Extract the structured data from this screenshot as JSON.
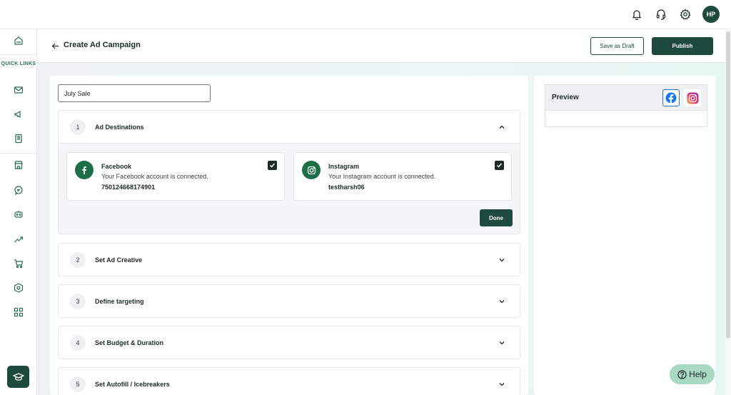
{
  "topbar": {
    "avatar_initials": "HP",
    "icons": [
      "bell-icon",
      "headset-icon",
      "settings-icon"
    ]
  },
  "sidebar": {
    "quick_links_label": "QUICK LINKS",
    "items": [
      "home-icon",
      "mail-icon",
      "megaphone-icon",
      "book-icon",
      "store-icon",
      "chat-icon",
      "bot-icon",
      "growth-icon",
      "cart-icon",
      "hexagon-icon",
      "apps-grid-icon",
      "academy-icon"
    ]
  },
  "header": {
    "title": "Create Ad Campaign",
    "save_draft_label": "Save as Draft",
    "publish_label": "Publish"
  },
  "campaign": {
    "name_value": "July Sale"
  },
  "steps": [
    {
      "number": "1",
      "title": "Ad Destinations",
      "expanded": true
    },
    {
      "number": "2",
      "title": "Set Ad Creative",
      "expanded": false
    },
    {
      "number": "3",
      "title": "Define targeting",
      "expanded": false
    },
    {
      "number": "4",
      "title": "Set Budget & Duration",
      "expanded": false
    },
    {
      "number": "5",
      "title": "Set Autofill / Icebreakers",
      "expanded": false
    }
  ],
  "destinations": [
    {
      "name": "Facebook",
      "description": "Your Facebook account is connected.",
      "account_id": "750124668174901",
      "checked": true,
      "icon": "facebook-icon"
    },
    {
      "name": "Instagram",
      "description": "Your Instagram account is connected.",
      "account_id": "testharsh06",
      "checked": true,
      "icon": "instagram-icon"
    }
  ],
  "done_label": "Done",
  "preview": {
    "title": "Preview",
    "platforms": [
      "facebook-icon",
      "instagram-icon"
    ],
    "selected": "facebook"
  },
  "help_label": "Help",
  "colors": {
    "brand": "#1d4a3c",
    "accent": "#1d6f47",
    "help_bg": "#a7d9c3"
  }
}
